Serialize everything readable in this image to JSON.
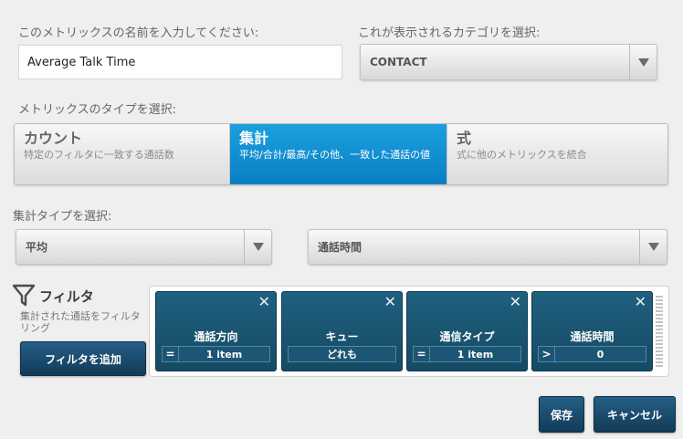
{
  "metric_name": {
    "label": "このメトリックスの名前を入力してください:",
    "value": "Average Talk Time"
  },
  "category": {
    "label": "これが表示されるカテゴリを選択:",
    "selected": "CONTACT"
  },
  "metric_type": {
    "label": "メトリックスのタイプを選択:",
    "options": [
      {
        "title": "カウント",
        "description": "特定のフィルタに一致する通話数"
      },
      {
        "title": "集計",
        "description": "平均/合計/最高/その他、一致した通話の値"
      },
      {
        "title": "式",
        "description": "式に他のメトリックスを統合"
      }
    ],
    "active_index": 1
  },
  "aggregation": {
    "label": "集計タイプを選択:",
    "function_selected": "平均",
    "field_selected": "通話時間"
  },
  "filters": {
    "title": "フィルタ",
    "description": "集計された通話をフィルタリング",
    "add_button": "フィルタを追加",
    "items": [
      {
        "name": "通話方向",
        "operator": "=",
        "value": "1 item"
      },
      {
        "name": "キュー",
        "operator": "",
        "value": "どれも"
      },
      {
        "name": "通信タイプ",
        "operator": "=",
        "value": "1 item"
      },
      {
        "name": "通話時間",
        "operator": ">",
        "value": "0"
      }
    ]
  },
  "actions": {
    "save": "保存",
    "cancel": "キャンセル"
  },
  "colors": {
    "active_blue": "#0a8fd6",
    "dark_navy": "#173f5b",
    "filter_tile": "#1b5673"
  }
}
